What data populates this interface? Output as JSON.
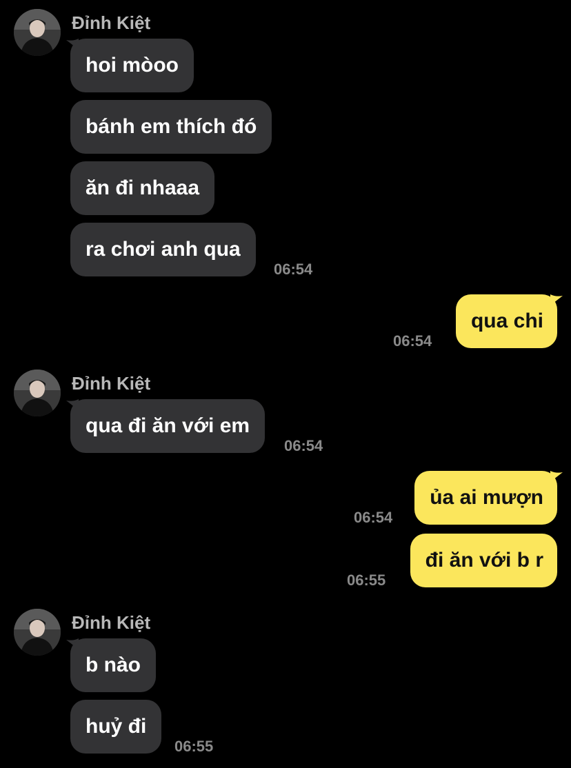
{
  "colors": {
    "background": "#000000",
    "incoming_bubble": "#333335",
    "outgoing_bubble": "#fbe65c",
    "sender_name": "#b8b8b8",
    "timestamp": "#8a8a8a"
  },
  "groups": [
    {
      "sender": "Đỉnh Kiệt",
      "messages": [
        "hoi mòoo",
        "bánh em thích đó",
        "ăn đi nhaaa",
        "ra chơi anh qua"
      ],
      "time": "06:54"
    },
    {
      "outgoing": true,
      "messages": [
        "qua chi"
      ],
      "time": "06:54"
    },
    {
      "sender": "Đỉnh Kiệt",
      "messages": [
        "qua đi ăn với em"
      ],
      "time": "06:54"
    },
    {
      "outgoing": true,
      "messages": [
        "ủa ai mượn",
        "đi ăn với b r"
      ],
      "times": [
        "06:54",
        "06:55"
      ]
    },
    {
      "sender": "Đỉnh Kiệt",
      "messages": [
        "b nào",
        "huỷ đi"
      ],
      "time": "06:55"
    }
  ]
}
